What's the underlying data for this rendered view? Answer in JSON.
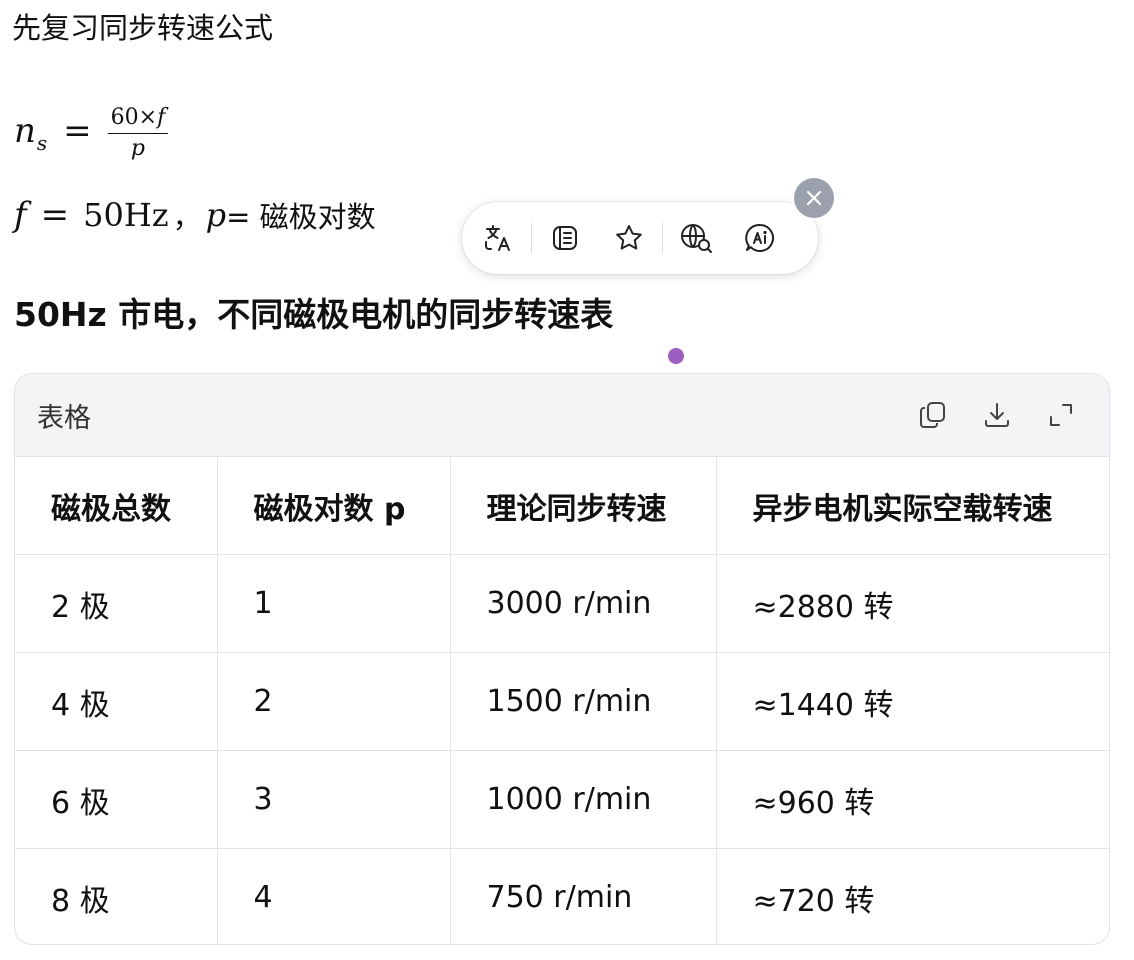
{
  "intro_text": "先复习同步转速公式",
  "formula1": {
    "lhs_var": "n",
    "lhs_sub": "s",
    "equals": "=",
    "numerator_num": "60×",
    "numerator_var": "f",
    "denominator": "p"
  },
  "formula2": {
    "f_var": "f",
    "equals": "=",
    "value": "50Hz",
    "separator": "，",
    "p_var": "p",
    "p_text": "= 磁极对数"
  },
  "toolbar": {
    "icons": [
      "translate-icon",
      "reader-icon",
      "favorite-icon",
      "web-search-icon",
      "ai-icon",
      "close-icon"
    ]
  },
  "heading": "50Hz 市电，不同磁极电机的同步转速表",
  "table_card": {
    "title": "表格",
    "actions": [
      "copy-icon",
      "download-icon",
      "expand-icon"
    ],
    "headers": [
      "磁极总数",
      "磁极对数 p",
      "理论同步转速",
      "异步电机实际空载转速"
    ],
    "rows": [
      [
        "2 极",
        "1",
        "3000 r/min",
        "≈2880 转"
      ],
      [
        "4 极",
        "2",
        "1500 r/min",
        "≈1440 转"
      ],
      [
        "6 极",
        "3",
        "1000 r/min",
        "≈960 转"
      ],
      [
        "8 极",
        "4",
        "750 r/min",
        "≈720 转"
      ]
    ]
  },
  "colors": {
    "close_button": "#9aa1ad",
    "indicator_dot": "#9b5fc0",
    "card_header_bg": "#f3f4f6",
    "border": "#e2e3e8"
  }
}
